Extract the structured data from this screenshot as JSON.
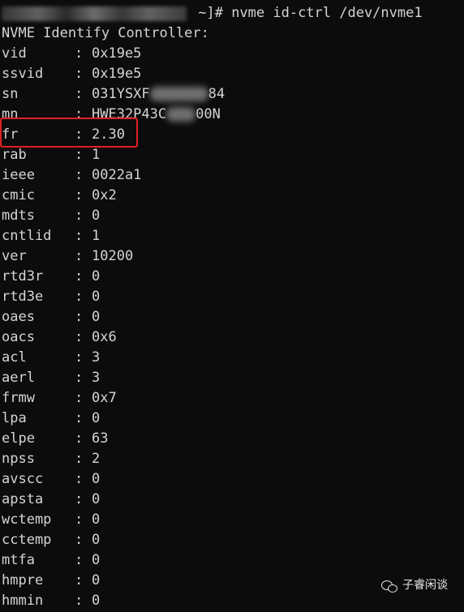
{
  "prompt": {
    "suffix": " ~]# ",
    "command": "nvme id-ctrl /dev/nvme1"
  },
  "heading": "NVME Identify Controller:",
  "separator": ": ",
  "fields": {
    "vid": {
      "key": "vid",
      "value": "0x19e5"
    },
    "ssvid": {
      "key": "ssvid",
      "value": "0x19e5"
    },
    "sn": {
      "key": "sn",
      "value_start": "031YSXF",
      "value_end": "84"
    },
    "mn": {
      "key": "mn",
      "value_start": "HWE32P43C",
      "value_end": "00N"
    },
    "fr": {
      "key": "fr",
      "value": "2.30"
    },
    "rab": {
      "key": "rab",
      "value": "1"
    },
    "ieee": {
      "key": "ieee",
      "value": "0022a1"
    },
    "cmic": {
      "key": "cmic",
      "value": "0x2"
    },
    "mdts": {
      "key": "mdts",
      "value": "0"
    },
    "cntlid": {
      "key": "cntlid",
      "value": "1"
    },
    "ver": {
      "key": "ver",
      "value": "10200"
    },
    "rtd3r": {
      "key": "rtd3r",
      "value": "0"
    },
    "rtd3e": {
      "key": "rtd3e",
      "value": "0"
    },
    "oaes": {
      "key": "oaes",
      "value": "0"
    },
    "oacs": {
      "key": "oacs",
      "value": "0x6"
    },
    "acl": {
      "key": "acl",
      "value": "3"
    },
    "aerl": {
      "key": "aerl",
      "value": "3"
    },
    "frmw": {
      "key": "frmw",
      "value": "0x7"
    },
    "lpa": {
      "key": "lpa",
      "value": "0"
    },
    "elpe": {
      "key": "elpe",
      "value": "63"
    },
    "npss": {
      "key": "npss",
      "value": "2"
    },
    "avscc": {
      "key": "avscc",
      "value": "0"
    },
    "apsta": {
      "key": "apsta",
      "value": "0"
    },
    "wctemp": {
      "key": "wctemp",
      "value": "0"
    },
    "cctemp": {
      "key": "cctemp",
      "value": "0"
    },
    "mtfa": {
      "key": "mtfa",
      "value": "0"
    },
    "hmpre": {
      "key": "hmpre",
      "value": "0"
    },
    "hmmin": {
      "key": "hmmin",
      "value": "0"
    }
  },
  "highlight_color": "#e02020",
  "watermark": {
    "icon": "wechat-icon",
    "text": "子睿闲谈"
  }
}
